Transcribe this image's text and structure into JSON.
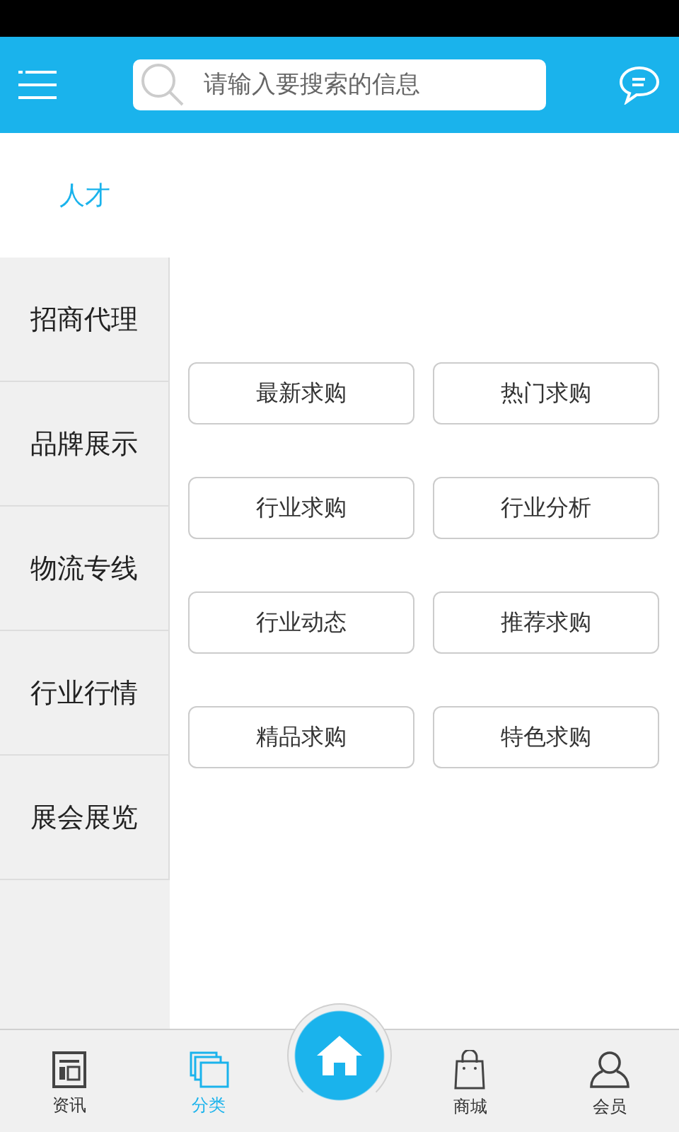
{
  "search": {
    "placeholder": "请输入要搜索的信息"
  },
  "sidebar": {
    "items": [
      {
        "label": "人才",
        "selected": true
      },
      {
        "label": "招商代理",
        "selected": false
      },
      {
        "label": "品牌展示",
        "selected": false
      },
      {
        "label": "物流专线",
        "selected": false
      },
      {
        "label": "行业行情",
        "selected": false
      },
      {
        "label": "展会展览",
        "selected": false
      }
    ]
  },
  "subcategories": [
    "最新求购",
    "热门求购",
    "行业求购",
    "行业分析",
    "行业动态",
    "推荐求购",
    "精品求购",
    "特色求购"
  ],
  "bottom_nav": [
    {
      "label": "资讯",
      "kind": "news",
      "selected": false
    },
    {
      "label": "分类",
      "kind": "category",
      "selected": true
    },
    {
      "kind": "home"
    },
    {
      "label": "商城",
      "kind": "shop",
      "selected": false
    },
    {
      "label": "会员",
      "kind": "member",
      "selected": false
    }
  ]
}
